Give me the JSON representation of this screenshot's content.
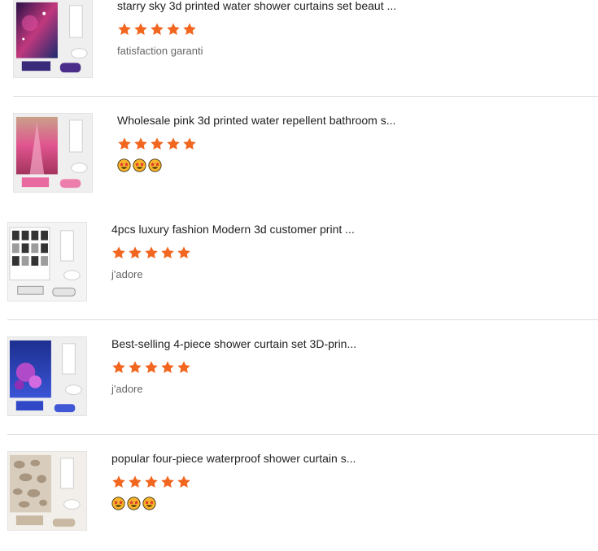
{
  "colors": {
    "star": "#f2661f",
    "divider": "#dcdcdc",
    "title": "#222222",
    "comment": "#666666"
  },
  "reviews": [
    {
      "title": "starry sky 3d printed water shower curtains set beaut ...",
      "rating": 5,
      "comment": "fatisfaction garanti",
      "emojis": []
    },
    {
      "title": "Wholesale pink 3d printed water repellent bathroom s...",
      "rating": 5,
      "comment": "",
      "emojis": [
        "star-struck-emoji",
        "star-struck-emoji",
        "star-struck-emoji"
      ]
    },
    {
      "title": "4pcs luxury fashion Modern 3d customer print ...",
      "rating": 5,
      "comment": "j'adore",
      "emojis": []
    },
    {
      "title": "Best-selling 4-piece shower curtain set 3D-prin...",
      "rating": 5,
      "comment": "j'adore",
      "emojis": []
    },
    {
      "title": "popular four-piece waterproof shower curtain s...",
      "rating": 5,
      "comment": "",
      "emojis": [
        "star-struck-emoji",
        "star-struck-emoji",
        "star-struck-emoji"
      ]
    }
  ]
}
